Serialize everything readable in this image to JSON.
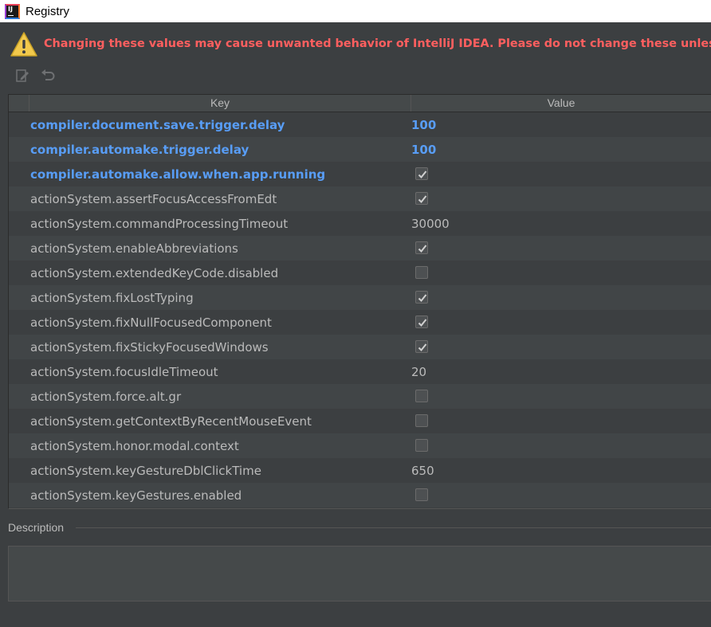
{
  "window": {
    "title": "Registry"
  },
  "warning": {
    "text": "Changing these values may cause unwanted behavior of IntelliJ IDEA. Please do not change these unless you ha"
  },
  "toolbar": {
    "icons": [
      "edit-icon",
      "revert-icon"
    ]
  },
  "table": {
    "columns": [
      "Key",
      "Value"
    ],
    "rows": [
      {
        "key": "compiler.document.save.trigger.delay",
        "value": "100",
        "type": "text",
        "modified": true
      },
      {
        "key": "compiler.automake.trigger.delay",
        "value": "100",
        "type": "text",
        "modified": true
      },
      {
        "key": "compiler.automake.allow.when.app.running",
        "value": true,
        "type": "checkbox",
        "modified": true
      },
      {
        "key": "actionSystem.assertFocusAccessFromEdt",
        "value": true,
        "type": "checkbox",
        "modified": false
      },
      {
        "key": "actionSystem.commandProcessingTimeout",
        "value": "30000",
        "type": "text",
        "modified": false
      },
      {
        "key": "actionSystem.enableAbbreviations",
        "value": true,
        "type": "checkbox",
        "modified": false
      },
      {
        "key": "actionSystem.extendedKeyCode.disabled",
        "value": false,
        "type": "checkbox",
        "modified": false
      },
      {
        "key": "actionSystem.fixLostTyping",
        "value": true,
        "type": "checkbox",
        "modified": false
      },
      {
        "key": "actionSystem.fixNullFocusedComponent",
        "value": true,
        "type": "checkbox",
        "modified": false
      },
      {
        "key": "actionSystem.fixStickyFocusedWindows",
        "value": true,
        "type": "checkbox",
        "modified": false
      },
      {
        "key": "actionSystem.focusIdleTimeout",
        "value": "20",
        "type": "text",
        "modified": false
      },
      {
        "key": "actionSystem.force.alt.gr",
        "value": false,
        "type": "checkbox",
        "modified": false
      },
      {
        "key": "actionSystem.getContextByRecentMouseEvent",
        "value": false,
        "type": "checkbox",
        "modified": false
      },
      {
        "key": "actionSystem.honor.modal.context",
        "value": false,
        "type": "checkbox",
        "modified": false
      },
      {
        "key": "actionSystem.keyGestureDblClickTime",
        "value": "650",
        "type": "text",
        "modified": false
      },
      {
        "key": "actionSystem.keyGestures.enabled",
        "value": false,
        "type": "checkbox",
        "modified": false
      }
    ]
  },
  "description": {
    "label": "Description",
    "text": ""
  },
  "colors": {
    "modified": "#589df6",
    "warning": "#ff5f5f",
    "background": "#3c3f41"
  }
}
